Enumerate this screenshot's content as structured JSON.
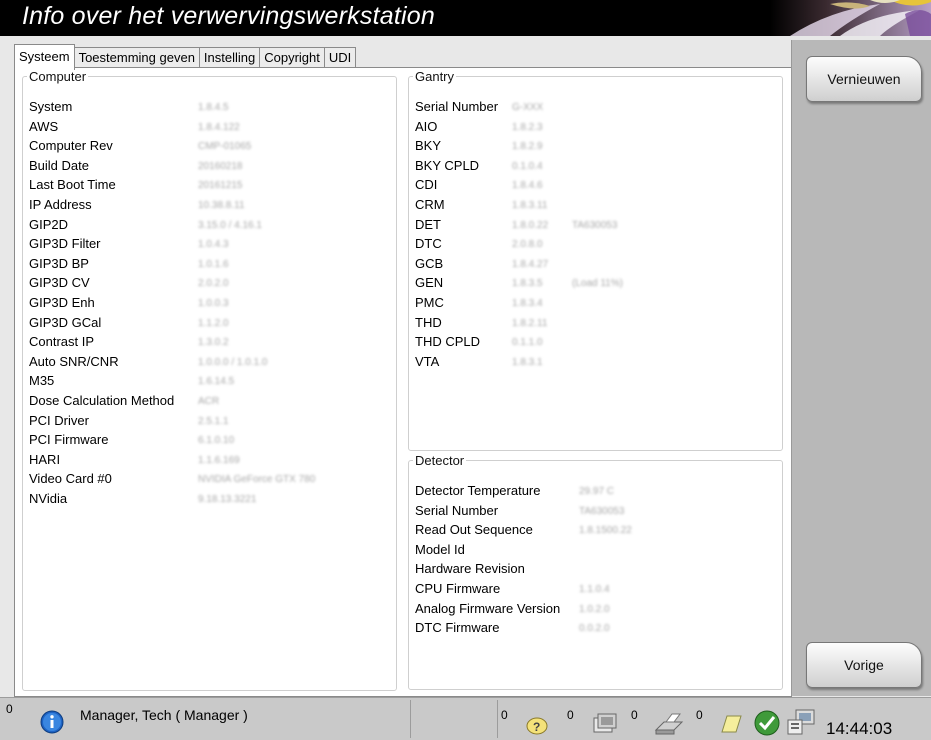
{
  "window": {
    "title": "Info over het verwervingswerkstation"
  },
  "tabs": [
    {
      "label": "Systeem",
      "active": true
    },
    {
      "label": "Toestemming geven"
    },
    {
      "label": "Instelling"
    },
    {
      "label": "Copyright"
    },
    {
      "label": "UDI"
    }
  ],
  "computer": {
    "legend": "Computer",
    "rows": [
      {
        "label": "System",
        "value": "1.8.4.5"
      },
      {
        "label": "AWS",
        "value": "1.8.4.122"
      },
      {
        "label": "Computer Rev",
        "value": "CMP-01065"
      },
      {
        "label": "Build Date",
        "value": "20160218"
      },
      {
        "label": "Last Boot Time",
        "value": "20161215"
      },
      {
        "label": "IP Address",
        "value": "10.38.8.11"
      },
      {
        "label": "GIP2D",
        "value": "3.15.0 / 4.16.1"
      },
      {
        "label": "GIP3D Filter",
        "value": "1.0.4.3"
      },
      {
        "label": "GIP3D BP",
        "value": "1.0.1.6"
      },
      {
        "label": "GIP3D CV",
        "value": "2.0.2.0"
      },
      {
        "label": "GIP3D Enh",
        "value": "1.0.0.3"
      },
      {
        "label": "GIP3D GCal",
        "value": "1.1.2.0"
      },
      {
        "label": "Contrast IP",
        "value": "1.3.0.2"
      },
      {
        "label": "Auto SNR/CNR",
        "value": "1.0.0.0 / 1.0.1.0"
      },
      {
        "label": "M35",
        "value": "1.6.14.5"
      },
      {
        "label": "Dose Calculation Method",
        "value": "ACR"
      },
      {
        "label": "PCI Driver",
        "value": "2.5.1.1"
      },
      {
        "label": "PCI Firmware",
        "value": "6.1.0.10"
      },
      {
        "label": "HARI",
        "value": "1.1.6.169"
      },
      {
        "label": "Video Card #0",
        "value": "NVIDIA GeForce GTX 780"
      },
      {
        "label": "NVidia",
        "value": "9.18.13.3221"
      }
    ]
  },
  "gantry": {
    "legend": "Gantry",
    "rows": [
      {
        "label": "Serial Number",
        "value": "G-XXX"
      },
      {
        "label": "AIO",
        "value": "1.8.2.3"
      },
      {
        "label": "BKY",
        "value": "1.8.2.9"
      },
      {
        "label": "BKY CPLD",
        "value": "0.1.0.4"
      },
      {
        "label": "CDI",
        "value": "1.8.4.6"
      },
      {
        "label": "CRM",
        "value": "1.8.3.11"
      },
      {
        "label": "DET",
        "value": "1.8.0.22",
        "extra": "TA630053"
      },
      {
        "label": "DTC",
        "value": "2.0.8.0"
      },
      {
        "label": "GCB",
        "value": "1.8.4.27"
      },
      {
        "label": "GEN",
        "value": "1.8.3.5",
        "extra": "(Load 11%)"
      },
      {
        "label": "PMC",
        "value": "1.8.3.4"
      },
      {
        "label": "THD",
        "value": "1.8.2.11"
      },
      {
        "label": "THD CPLD",
        "value": "0.1.1.0"
      },
      {
        "label": "VTA",
        "value": "1.8.3.1"
      }
    ]
  },
  "detector": {
    "legend": "Detector",
    "rows": [
      {
        "label": "Detector Temperature",
        "value": "29.97 C"
      },
      {
        "label": "Serial Number",
        "value": "TA630053"
      },
      {
        "label": "Read Out Sequence",
        "value": "1.8.1500.22"
      },
      {
        "label": "Model Id",
        "value": ""
      },
      {
        "label": "Hardware Revision",
        "value": ""
      },
      {
        "label": "CPU Firmware",
        "value": "1.1.0.4"
      },
      {
        "label": "Analog Firmware Version",
        "value": "1.0.2.0"
      },
      {
        "label": "DTC Firmware",
        "value": "0.0.2.0"
      }
    ]
  },
  "sidebar": {
    "refresh_label": "Vernieuwen",
    "back_label": "Vorige"
  },
  "statusbar": {
    "alert_count": "0",
    "user": "Manager, Tech ( Manager )",
    "help_count": "0",
    "queue_count": "0",
    "print_count": "0",
    "notes_count": "0",
    "time": "14:44:03"
  }
}
